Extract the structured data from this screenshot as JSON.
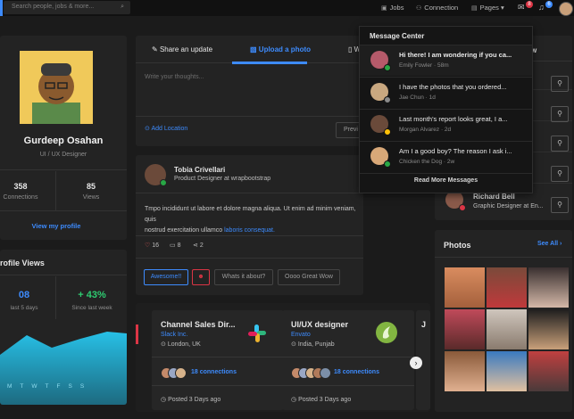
{
  "topbar": {
    "search_placeholder": "Search people, jobs & more...",
    "nav": {
      "jobs": "Jobs",
      "connection": "Connection",
      "pages": "Pages"
    },
    "messages_count": "8",
    "notifications_count": "6"
  },
  "profile": {
    "name": "Gurdeep Osahan",
    "role": "UI / UX Designer",
    "connections_value": "358",
    "connections_label": "Connections",
    "views_value": "85",
    "views_label": "Views",
    "view_profile": "View my profile"
  },
  "profile_views": {
    "title": "rofile Views",
    "stat1_value": "08",
    "stat1_label": "last 5 days",
    "stat2_value": "+ 43%",
    "stat2_label": "Since last week",
    "axis_days": [
      "M",
      "T",
      "W",
      "T",
      "F",
      "S",
      "S"
    ]
  },
  "composer": {
    "tab_share": "Share an update",
    "tab_upload": "Upload a photo",
    "tab_3": "W",
    "placeholder": "Write your thoughts...",
    "add_location": "Add Location",
    "preview": "Previ"
  },
  "post": {
    "author": "Tobia Crivellari",
    "title": "Product Designer at wrapbootstrap",
    "body_a": "Tmpo incididunt ut labore et dolore magna aliqua. Ut enim ad minim veniam, quis",
    "body_b": "nostrud exercitation ullamco ",
    "body_link": "laboris consequat.",
    "likes": "16",
    "comments": "8",
    "shares": "2",
    "reply_1": "Awesome!!",
    "reply_2": "Whats it about?",
    "reply_3": "Oooo Great Wow"
  },
  "jobs": [
    {
      "title": "Channel Sales Dir...",
      "company": "Slack Inc.",
      "location": "London, UK",
      "connections": "18 connections",
      "posted": "Posted 3 Days ago"
    },
    {
      "title": "UI/UX designer",
      "company": "Envato",
      "location": "India, Punjab",
      "connections": "18 connections",
      "posted": "Posted 3 Days ago"
    },
    {
      "title": "J"
    }
  ],
  "messages": {
    "header": "Message Center",
    "items": [
      {
        "text": "Hi there! I am wondering if you ca...",
        "meta": "Emily Fowler · 58m"
      },
      {
        "text": "I have the photos that you ordered...",
        "meta": "Jae Chun · 1d"
      },
      {
        "text": "Last month's report looks great, I a...",
        "meta": "Morgan Alvarez · 2d"
      },
      {
        "text": "Am I a good boy? The reason I ask i...",
        "meta": "Chicken the Dog · 2w"
      }
    ],
    "read_more": "Read More Messages"
  },
  "people": {
    "partial_title": "w",
    "richard_name": "Richard Bell",
    "richard_title": "Graphic Designer at En..."
  },
  "photos": {
    "title": "Photos",
    "see_all": "See All"
  },
  "colors": {
    "accent": "#3d8bfd",
    "online": "#28a745",
    "chart_fill": "#27c0e6"
  }
}
